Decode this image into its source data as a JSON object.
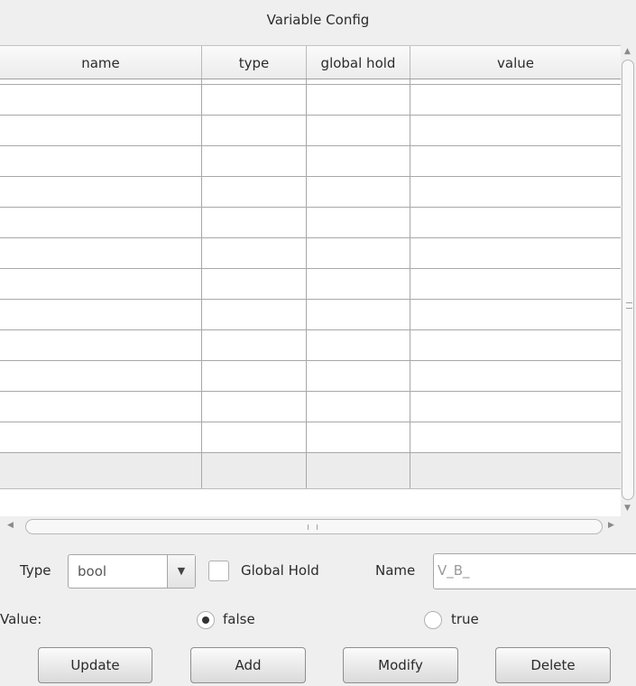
{
  "window": {
    "title": "Variable Config"
  },
  "table": {
    "columns": [
      "name",
      "type",
      "global hold",
      "value"
    ],
    "rows": []
  },
  "form": {
    "type_label": "Type",
    "type_value": "bool",
    "global_hold_label": "Global Hold",
    "global_hold_checked": false,
    "name_label": "Name",
    "name_value": "V_B_",
    "value_label": "Value:",
    "value_options": [
      {
        "label": "false",
        "selected": true
      },
      {
        "label": "true",
        "selected": false
      }
    ]
  },
  "buttons": {
    "update": "Update",
    "add": "Add",
    "modify": "Modify",
    "delete": "Delete"
  },
  "icons": {
    "combo_arrow": "chevron-down-icon",
    "scroll_up": "arrow-up-icon",
    "scroll_down": "arrow-down-icon",
    "scroll_left": "arrow-left-icon",
    "scroll_right": "arrow-right-icon"
  }
}
